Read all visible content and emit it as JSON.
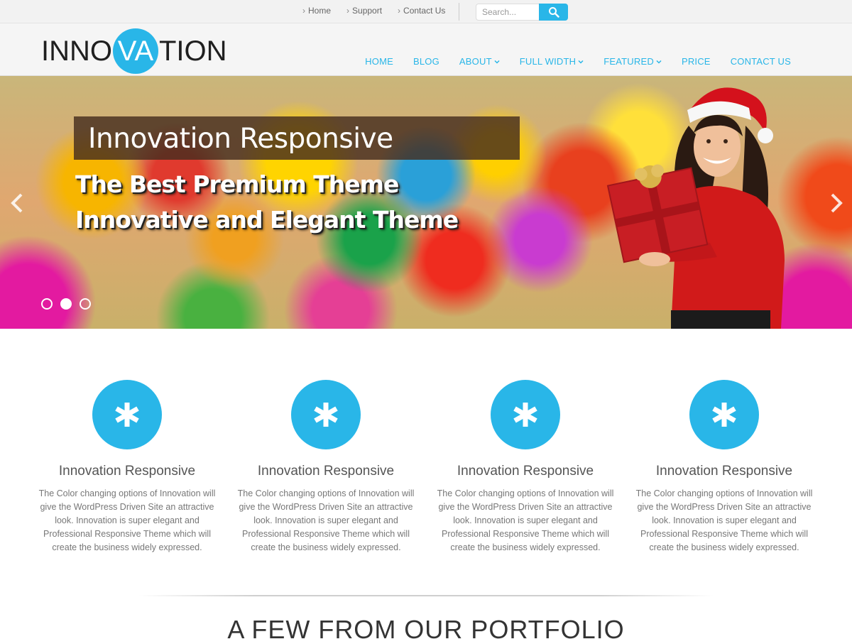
{
  "topbar": {
    "links": [
      "Home",
      "Support",
      "Contact Us"
    ],
    "search_placeholder": "Search..."
  },
  "header": {
    "logo_parts": [
      "INNO",
      "VA",
      "TION"
    ],
    "nav": [
      "HOME",
      "BLOG",
      "ABOUT",
      "FULL WIDTH",
      "FEATURED",
      "PRICE",
      "CONTACT US"
    ]
  },
  "hero": {
    "title": "Innovation Responsive",
    "line1": "The Best Premium Theme",
    "line2": "Innovative and Elegant Theme",
    "slide_count": 3,
    "active_slide": 2
  },
  "features": [
    {
      "title": "Innovation Responsive",
      "text": "The Color changing options of Innovation will give the WordPress Driven Site an attractive look. Innovation is super elegant and Professional Responsive Theme which will create the business widely expressed."
    },
    {
      "title": "Innovation Responsive",
      "text": "The Color changing options of Innovation will give the WordPress Driven Site an attractive look. Innovation is super elegant and Professional Responsive Theme which will create the business widely expressed."
    },
    {
      "title": "Innovation Responsive",
      "text": "The Color changing options of Innovation will give the WordPress Driven Site an attractive look. Innovation is super elegant and Professional Responsive Theme which will create the business widely expressed."
    },
    {
      "title": "Innovation Responsive",
      "text": "The Color changing options of Innovation will give the WordPress Driven Site an attractive look. Innovation is super elegant and Professional Responsive Theme which will create the business widely expressed."
    }
  ],
  "portfolio": {
    "title": "A FEW FROM OUR PORTFOLIO"
  },
  "colors": {
    "accent": "#29b6e8",
    "header_bg": "#f5f5f5",
    "topbar_bg": "#f2f2f2"
  }
}
